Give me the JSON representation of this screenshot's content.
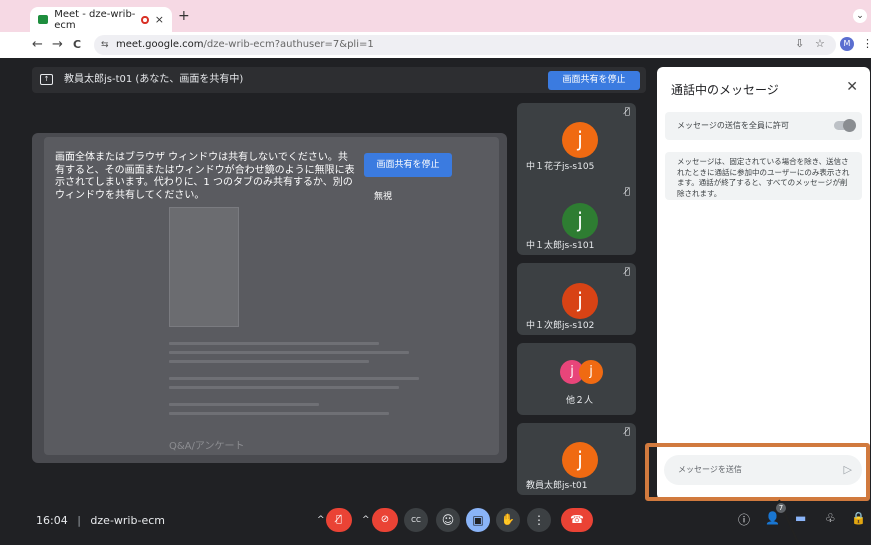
{
  "browser": {
    "tab_title": "Meet - dze-wrib-ecm",
    "tab_close": "×",
    "new_tab": "+",
    "tab_menu": "⌄",
    "back": "←",
    "forward": "→",
    "reload": "C",
    "url_host": "meet.google.com",
    "url_path": "/dze-wrib-ecm?authuser=7&pli=1",
    "site_info": "⇆",
    "download": "⇩",
    "star": "☆",
    "profile": "M",
    "menu": "⋮"
  },
  "sharebar": {
    "icon": "↑",
    "text": "教員太郎js-t01 (あなた、画面を共有中)",
    "stop_label": "画面共有を停止"
  },
  "warning": {
    "text": "画面全体またはブラウザ ウィンドウは共有しないでください。共有すると、その画面またはウィンドウが合わせ鏡のように無限に表示されてしまいます。代わりに、1 つのタブのみ共有するか、別のウィンドウを共有してください。",
    "stop_label": "画面共有を停止",
    "ignore_label": "無視"
  },
  "shared_content": {
    "heading": "Q&A/アンケート"
  },
  "participants": [
    {
      "initial": "j",
      "name": "中１花子js-s105",
      "color": "#f06a12",
      "mic": "🎙̸"
    },
    {
      "initial": "j",
      "name": "中１太郎js-s101",
      "color": "#2e7d32",
      "mic": "🎙̸"
    },
    {
      "initial": "j",
      "name": "中１次郎js-s102",
      "color": "#d84315",
      "mic": "🎙̸"
    },
    {
      "initial": "j",
      "name": "教員太郎js-t01",
      "color": "#f06a12",
      "mic": "🎙̸"
    }
  ],
  "others": {
    "label": "他２人",
    "avatars": [
      {
        "initial": "j",
        "color": "#e8457a"
      },
      {
        "initial": "j",
        "color": "#f06a12"
      }
    ]
  },
  "chat": {
    "title": "通話中のメッセージ",
    "close": "✕",
    "allow_label": "メッセージの送信を全員に許可",
    "allow_enabled": true,
    "info": "メッセージは、固定されている場合を除き、送信されたときに通話に参加中のユーザーにのみ表示されます。通話が終了すると、すべてのメッセージが削除されます。",
    "input_placeholder": "メッセージを送信",
    "send_icon": "▷"
  },
  "bottom": {
    "time": "16:04",
    "separator": "|",
    "meeting_code": "dze-wrib-ecm",
    "controls": {
      "caret": "^",
      "mic_off": "🎙̸",
      "cam_off": "⊘",
      "captions": "CC",
      "emoji": "☺",
      "present": "▣",
      "hand": "✋",
      "more": "⋮",
      "hangup": "☎"
    },
    "right": {
      "info": "ⓘ",
      "people": "👤",
      "people_count": "7",
      "chat": "▬",
      "activities": "♧",
      "lock": "🔒"
    }
  }
}
